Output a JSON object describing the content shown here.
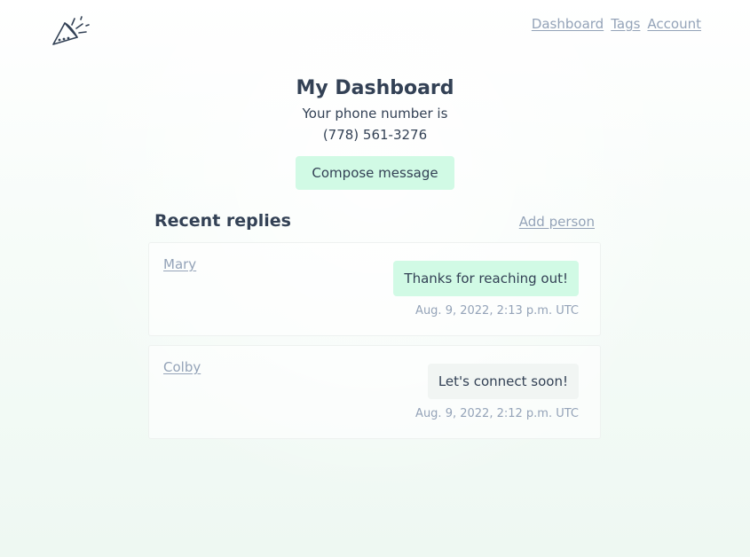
{
  "nav": {
    "items": [
      {
        "label": "Dashboard"
      },
      {
        "label": "Tags"
      },
      {
        "label": "Account"
      }
    ]
  },
  "header": {
    "title": "My Dashboard",
    "phone_prefix": "Your phone number is",
    "phone_number": "(778) 561-3276",
    "compose_label": "Compose message"
  },
  "replies": {
    "section_title": "Recent replies",
    "add_person_label": "Add person",
    "items": [
      {
        "name": "Mary",
        "message": "Thanks for reaching out!",
        "timestamp": "Aug. 9, 2022, 2:13 p.m. UTC",
        "bubble_color": "#d1fae5"
      },
      {
        "name": "Colby",
        "message": "Let's connect soon!",
        "timestamp": "Aug. 9, 2022, 2:12 p.m. UTC",
        "bubble_color": "#f1f5f3"
      }
    ]
  },
  "icons": {
    "logo": "party-popper-icon"
  },
  "colors": {
    "accent": "#d1fae5",
    "text": "#334155",
    "muted": "#94a3b8"
  }
}
